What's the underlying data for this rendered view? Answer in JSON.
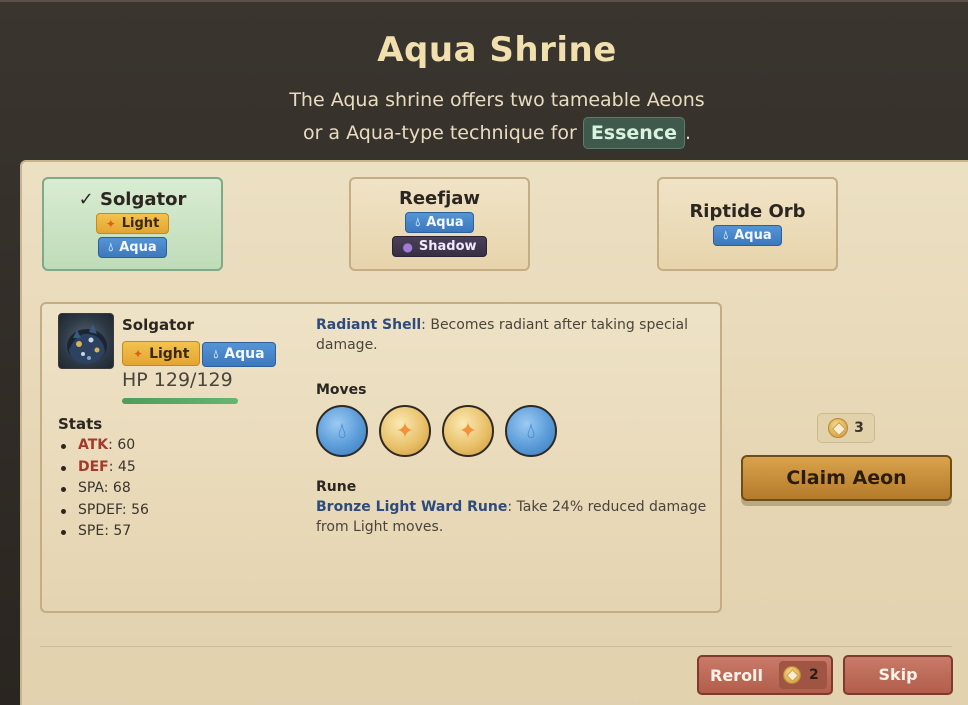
{
  "header": {
    "title": "Aqua Shrine",
    "subtitle_line1": "The Aqua shrine offers two tameable Aeons",
    "subtitle_line2_pre": "or a Aqua-type technique for",
    "subtitle_tag": "Essence",
    "subtitle_line2_post": "."
  },
  "choices": [
    {
      "name": "✓ Solgator",
      "selected": true,
      "types": [
        "Light",
        "Aqua"
      ]
    },
    {
      "name": "Reefjaw",
      "selected": false,
      "types": [
        "Aqua",
        "Shadow"
      ]
    },
    {
      "name": "Riptide Orb",
      "selected": false,
      "types": [
        "Aqua"
      ]
    }
  ],
  "details": {
    "name": "Solgator",
    "types": [
      "Light",
      "Aqua"
    ],
    "hp": "HP 129/129",
    "hp_fraction": 1.0,
    "stats_heading": "Stats",
    "stats": [
      {
        "label": "ATK",
        "value": ": 60",
        "highlight": true
      },
      {
        "label": "DEF",
        "value": ": 45",
        "highlight": true
      },
      {
        "label": "SPA",
        "value": ": 68",
        "highlight": false
      },
      {
        "label": "SPDEF",
        "value": ": 56",
        "highlight": false
      },
      {
        "label": "SPE",
        "value": ": 57",
        "highlight": false
      }
    ],
    "ability_name": "Radiant Shell",
    "ability_text": ": Becomes radiant after taking special damage.",
    "moves_heading": "Moves",
    "moves": [
      "Aqua",
      "Light",
      "Light",
      "Aqua"
    ],
    "rune_heading": "Rune",
    "rune_name": "Bronze Light Ward Rune",
    "rune_text": ": Take 24% reduced damage from Light moves."
  },
  "claim": {
    "cost": "3",
    "label": "Claim Aeon"
  },
  "footer": {
    "reroll_label": "Reroll",
    "reroll_cost": "2",
    "skip_label": "Skip"
  },
  "colors": {
    "light": "#e9b440",
    "aqua": "#4a88c9",
    "shadow": "#3f3650",
    "selected": "#c9e3c2",
    "claim": "#c98f3a",
    "danger": "#b96553"
  },
  "icons": {
    "light": "sparkle-icon",
    "aqua": "water-drop-icon",
    "shadow": "shadow-orb-icon",
    "currency": "essence-gem-icon"
  }
}
